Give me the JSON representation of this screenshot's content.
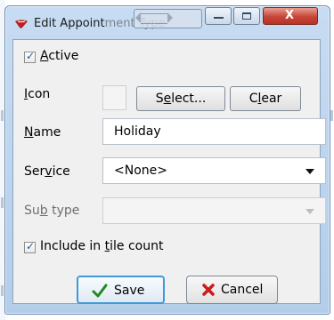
{
  "window": {
    "title_start": "Edit Appoint",
    "title_obscured": "ment Type"
  },
  "form": {
    "active": {
      "checked": true,
      "label_underlined": "A",
      "label_rest": "ctive"
    },
    "icon": {
      "label_underlined": "I",
      "label_rest": "con",
      "select_prefix": "S",
      "select_underlined": "e",
      "select_rest": "lect...",
      "clear_prefix": "C",
      "clear_underlined": "l",
      "clear_rest": "ear"
    },
    "name": {
      "label_underlined": "N",
      "label_rest": "ame",
      "value": "Holiday"
    },
    "service": {
      "label_prefix": "Ser",
      "label_underlined": "v",
      "label_rest": "ice",
      "value": "<None>"
    },
    "subtype": {
      "label_prefix": "Su",
      "label_underlined": "b",
      "label_rest": " type",
      "value": ""
    },
    "include": {
      "checked": true,
      "label_prefix": "Include in ",
      "label_underlined": "t",
      "label_rest": "ile count"
    }
  },
  "buttons": {
    "save": "Save",
    "cancel": "Cancel"
  },
  "colors": {
    "title_bar": "#c4daf2",
    "client_bg": "#f0f0f0",
    "save_accent": "#3f9ad7",
    "cancel_icon": "#d01919"
  }
}
